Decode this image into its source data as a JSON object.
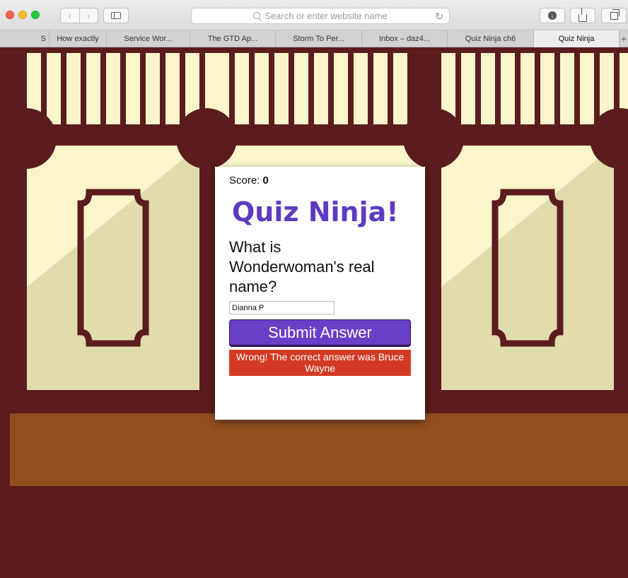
{
  "browser": {
    "address_placeholder": "Search or enter website name",
    "back_glyph": "‹",
    "forward_glyph": "›",
    "reload_glyph": "↻",
    "download_glyph": "↓",
    "new_tab_glyph": "+",
    "tabs": [
      {
        "label": "S"
      },
      {
        "label": "How exactly"
      },
      {
        "label": "Service Wor..."
      },
      {
        "label": "The GTD Ap..."
      },
      {
        "label": "Storm To Per..."
      },
      {
        "label": "Inbox – daz4..."
      },
      {
        "label": "Quiz Ninja ch6"
      },
      {
        "label": "Quiz Ninja",
        "active": true
      }
    ]
  },
  "quiz": {
    "score_label": "Score: ",
    "score_value": "0",
    "title": "Quiz Ninja!",
    "question": "What is Wonderwoman's real name?",
    "answer_value": "Dianna P",
    "submit_label": "Submit Answer",
    "feedback": "Wrong! The correct answer was Bruce Wayne"
  },
  "colors": {
    "background": "#5b1c1d",
    "cream": "#fbf5cb",
    "counter": "#924d20",
    "title_purple": "#5d3bc0",
    "button_purple": "#6a3fc7",
    "feedback_red": "#d23a25"
  }
}
